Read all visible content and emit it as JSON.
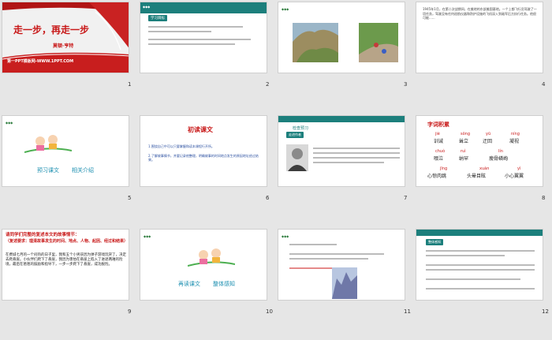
{
  "slides": [
    {
      "num": "1",
      "title": "走一步，再走一步",
      "author": "莫顿·亨特",
      "footer": "第一PPT模板网-WWW.1PPT.COM"
    },
    {
      "num": "2",
      "heading": "学习目标"
    },
    {
      "num": "3"
    },
    {
      "num": "4",
      "text": "1945年1月，在第二次战期间，在美地的东部美国基地。一个上都飞行员驾驶了一项任务，驾驶没有任何巡航仪器和防护设施的飞机深入到敌军后方执行任务。他很可能......"
    },
    {
      "num": "5",
      "tag1": "预习课文",
      "tag2": "相关介绍"
    },
    {
      "num": "6",
      "title": "初读课文",
      "p1": "1.围绕自己中可以只要掌握和读本课程行开所。",
      "p2": "2.了解故事情节，并要记录他整理，明确故事的时间地点发生的原因地址经过结果。"
    },
    {
      "num": "7",
      "heading": "检查预习",
      "subheading": "走进作者"
    },
    {
      "num": "8",
      "heading": "字词积累",
      "row1": [
        {
          "py": "jiè",
          "hz": "训诫"
        },
        {
          "py": "sǒng",
          "hz": "耸立"
        },
        {
          "py": "yū",
          "hz": "迂回"
        },
        {
          "py": "níng",
          "hz": "凝视"
        }
      ],
      "row2": [
        {
          "py": "chuò",
          "hz": "啜泣"
        },
        {
          "py": "ruì",
          "hz": "纳罕"
        },
        {
          "py": "lín",
          "hz": "瘦骨嶙峋"
        }
      ],
      "row3": [
        {
          "py": "jīng",
          "hz": "心惊肉跳"
        },
        {
          "py": "xuàn",
          "hz": "头晕目眩"
        },
        {
          "py": "yì",
          "hz": "小心翼翼"
        }
      ]
    },
    {
      "num": "9",
      "title": "请同学们完整的复述本文的故事情节：",
      "subtitle": "（复述要求：理清故事发生的时间、地点、人物、起因、经过和结果）",
      "body": "在费城七月的一个闷热的日子里，我和五个小男孩因为弹子游戏玩厌了，决定去爬悬崖。小伙伴们爬下了悬崖，我因为害怕在悬崖上陷入了进退两难的险境，最后在爸爸的鼓励和指导下，一步一步爬下了悬崖，成功脱险。"
    },
    {
      "num": "10",
      "tag1": "再读课文",
      "tag2": "整体感知"
    },
    {
      "num": "11"
    },
    {
      "num": "12",
      "heading": "整体感知"
    }
  ]
}
